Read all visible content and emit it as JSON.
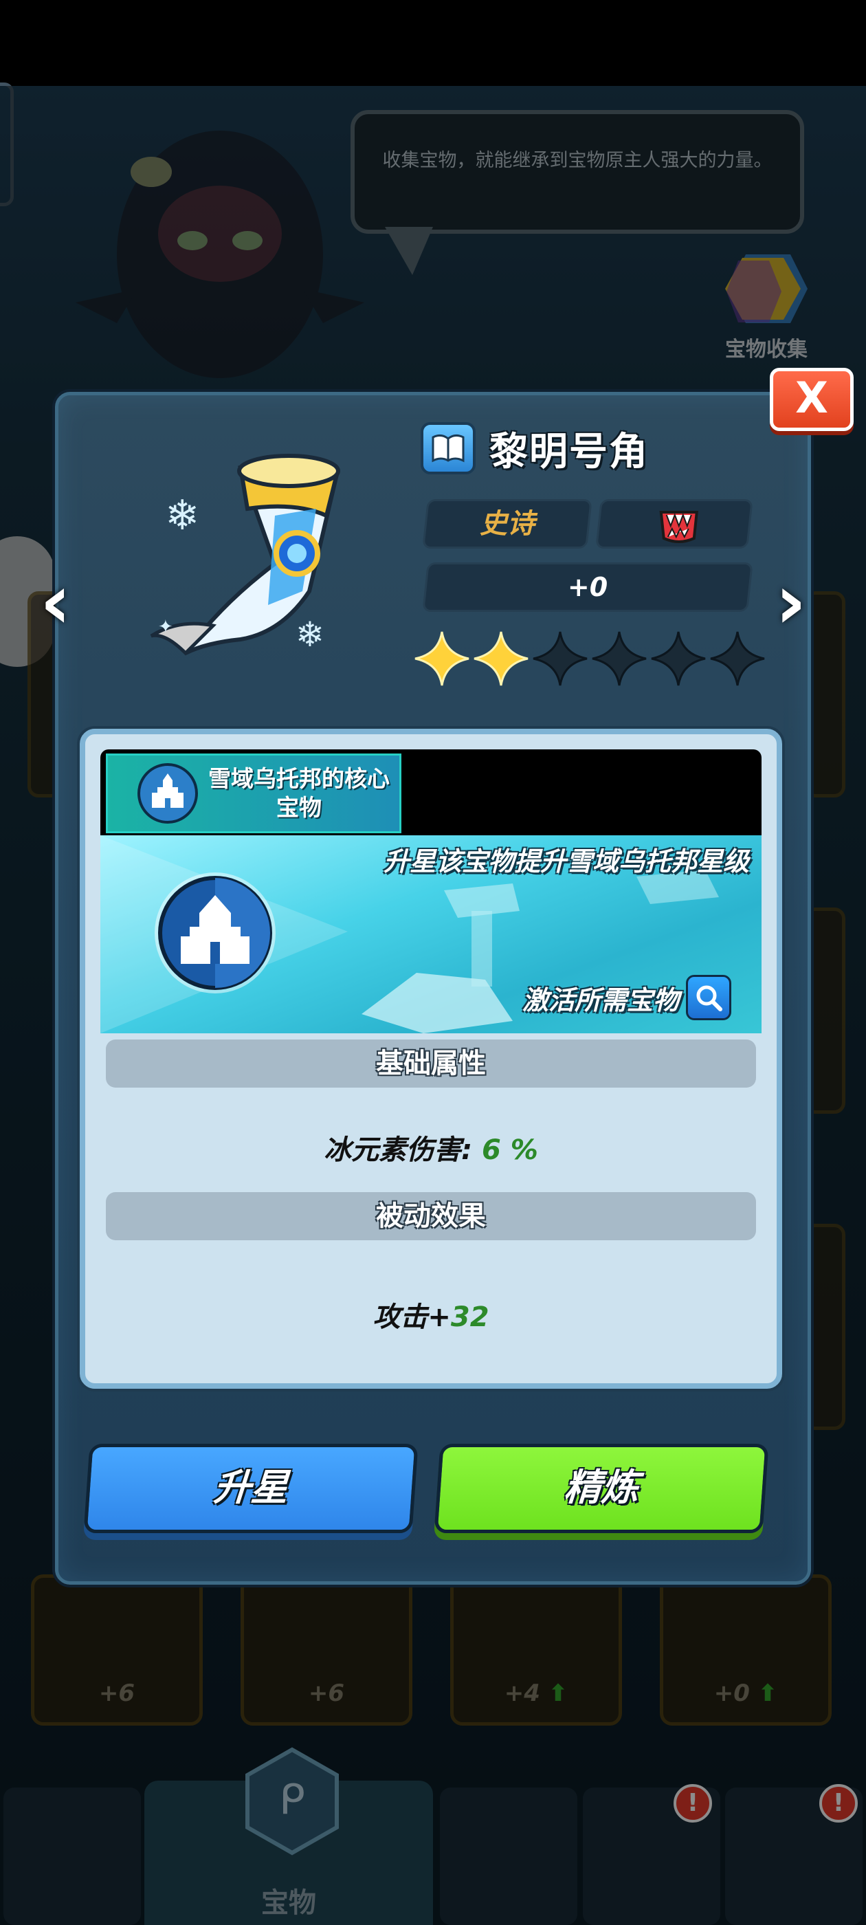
{
  "background": {
    "speech_text": "收集宝物，就能继承到宝物原主人强大的力量。",
    "collection_button_label": "宝物收集",
    "cards": [
      {
        "level": "+6",
        "upgrade": false
      },
      {
        "level": "+6",
        "upgrade": false
      },
      {
        "level": "+4",
        "upgrade": true
      },
      {
        "level": "+0",
        "upgrade": true
      }
    ],
    "nav": {
      "active_label": "宝物"
    }
  },
  "item": {
    "name": "黎明号角",
    "rarity": "史诗",
    "type_icon": "fanged-mouth-icon",
    "level": "+0",
    "stars_filled": 2,
    "stars_total": 6
  },
  "set": {
    "name": "雪域乌托邦的核心宝物",
    "description": "升星该宝物提升雪域乌托邦星级",
    "activate_label": "激活所需宝物",
    "emblem_icon": "ice-castle-icon"
  },
  "stats": {
    "base_header": "基础属性",
    "base_label": "冰元素伤害:",
    "base_value": "6 %",
    "passive_header": "被动效果",
    "passive_label": "攻击+",
    "passive_value": "32"
  },
  "buttons": {
    "upgrade_star": "升星",
    "refine": "精炼",
    "close": "X"
  },
  "colors": {
    "rarity_epic": "#e8b146",
    "star_filled": "#ffd23a",
    "upgrade_button": "#3a97f5",
    "refine_button": "#7eed2a",
    "close_button": "#e8502d",
    "stat_value": "#2c8a2a"
  }
}
